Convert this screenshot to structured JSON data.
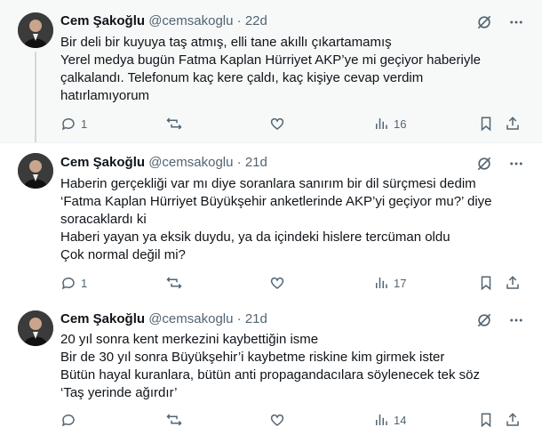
{
  "tweets": [
    {
      "name": "Cem Şakoğlu",
      "handle": "@cemsakoglu",
      "dot": "·",
      "time": "22d",
      "lines": [
        "Bir deli bir kuyuya taş atmış, elli tane akıllı çıkartamamış",
        "Yerel medya bugün Fatma Kaplan Hürriyet AKP’ye mi geçiyor haberiyle",
        "çalkalandı. Telefonum kaç kere çaldı, kaç kişiye cevap verdim",
        "hatırlamıyorum"
      ],
      "replies": "1",
      "reposts": "",
      "likes": "",
      "views": "16"
    },
    {
      "name": "Cem Şakoğlu",
      "handle": "@cemsakoglu",
      "dot": "·",
      "time": "21d",
      "lines": [
        "Haberin gerçekliği var mı diye soranlara sanırım bir dil sürçmesi dedim",
        "‘Fatma Kaplan Hürriyet Büyükşehir anketlerinde AKP’yi geçiyor mu?’ diye",
        "soracaklardı ki",
        "Haberi yayan ya eksik duydu, ya da içindeki hislere tercüman oldu",
        "Çok normal değil mi?"
      ],
      "replies": "1",
      "reposts": "",
      "likes": "",
      "views": "17"
    },
    {
      "name": "Cem Şakoğlu",
      "handle": "@cemsakoglu",
      "dot": "·",
      "time": "21d",
      "lines": [
        "20 yıl sonra kent merkezini kaybettiğin isme",
        "Bir de 30 yıl sonra Büyükşehir’i kaybetme riskine kim girmek ister",
        "Bütün hayal kuranlara, bütün anti propagandacılara söylenecek tek söz",
        "‘Taş yerinde ağırdır’"
      ],
      "replies": "",
      "reposts": "",
      "likes": "",
      "views": "14"
    }
  ],
  "icons": {
    "header": [
      "grok-icon",
      "more-icon"
    ],
    "actions": [
      "reply-icon",
      "repost-icon",
      "like-icon",
      "views-icon",
      "bookmark-icon",
      "share-icon"
    ]
  },
  "colors": {
    "text": "#0f1419",
    "secondary": "#536471",
    "thread_line": "#cfd9de"
  }
}
